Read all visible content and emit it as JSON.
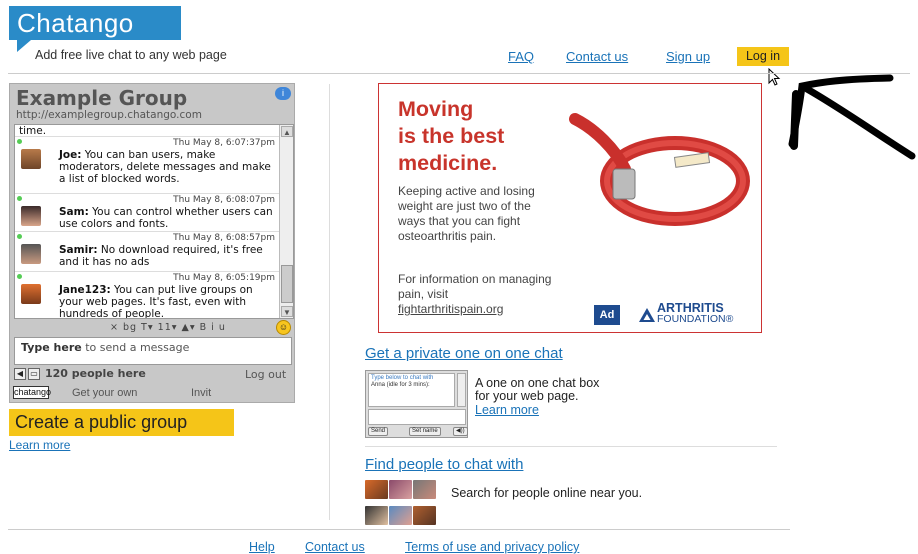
{
  "brand": {
    "name": "Chatango",
    "tagline": "Add free live chat to any web page",
    "color": "#2a8bc8"
  },
  "nav": {
    "faq": "FAQ",
    "contact": "Contact us",
    "signup": "Sign up",
    "login": "Log in",
    "login_bg": "#f5c518"
  },
  "widget": {
    "title": "Example Group",
    "url": "http://examplegroup.chatango.com",
    "partial_line": "time.",
    "messages": [
      {
        "time": "Thu May 8, 6:07:37pm",
        "user": "Joe:",
        "text": " You can ban users, make moderators, delete messages and make a list of blocked words."
      },
      {
        "time": "Thu May 8, 6:08:07pm",
        "user": "Sam:",
        "text": " You can control whether users can use colors and fonts."
      },
      {
        "time": "Thu May 8, 6:08:57pm",
        "user": "Samir:",
        "text": " No download required, it's free and it has no ads"
      },
      {
        "time": "Thu May 8, 6:05:19pm",
        "user": "Jane123:",
        "text": " You can put live groups on your web pages.  It's fast, even with hundreds of people."
      }
    ],
    "format_bar": "× bg T▾ 11▾ ▲▾ B i u",
    "input_placeholder_bold": "Type here",
    "input_placeholder_rest": " to send a message",
    "people_count": "120 people here",
    "logout": "Log out",
    "mini_logo": "chatango",
    "get_own": "Get your own",
    "invite": "Invit"
  },
  "create_group": {
    "label": "Create a public group",
    "learn_more": "Learn more"
  },
  "ad": {
    "headline": [
      "Moving",
      "is the best",
      "medicine."
    ],
    "body": "Keeping active and losing weight are just two of the ways that you can fight osteoarthritis pain.",
    "info_text": "For information on managing pain, visit",
    "info_link": "fightarthritispain.org",
    "council_logo": "Ad",
    "arthritis_logo": [
      "ARTHRITIS",
      "FOUNDATION®"
    ],
    "accent": "#c8342b"
  },
  "private_chat": {
    "title": "Get a private one on one chat",
    "desc": [
      "A one on one chat box",
      "for your web page."
    ],
    "learn_more": "Learn more",
    "mini_text_1": "Type below to chat with",
    "mini_text_2": "Anna (idle for 3 mins):",
    "mini_send": "Send",
    "mini_setname": "Set name",
    "mini_sound": "◀))"
  },
  "find_people": {
    "title": "Find people to chat with",
    "desc": "Search for people online near you."
  },
  "footer": {
    "help": "Help",
    "contact": "Contact us",
    "terms": "Terms of use and privacy policy"
  }
}
